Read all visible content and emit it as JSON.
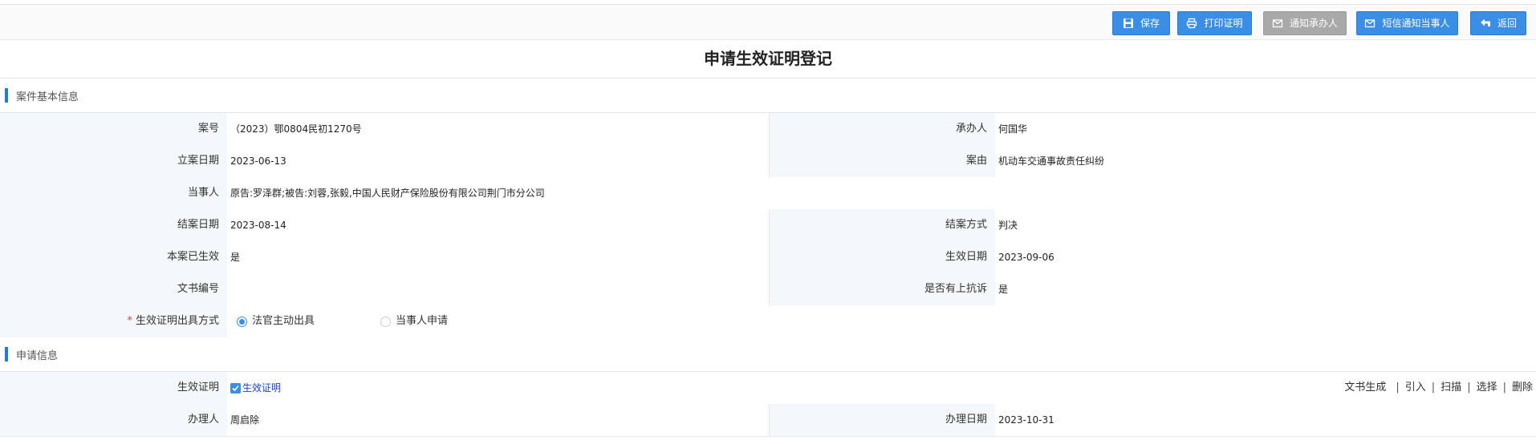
{
  "toolbar": {
    "save_label": "保存",
    "print_label": "打印证明",
    "notify_handler_label": "通知承办人",
    "sms_notify_label": "短信通知当事人",
    "back_label": "返回"
  },
  "page_title": "申请生效证明登记",
  "sections": {
    "case_info": "案件基本信息",
    "apply_info": "申请信息"
  },
  "case": {
    "case_no_label": "案号",
    "case_no": "（2023）鄂0804民初1270号",
    "handler_label": "承办人",
    "handler": "何国华",
    "filing_date_label": "立案日期",
    "filing_date": "2023-06-13",
    "cause_label": "案由",
    "cause": "机动车交通事故责任纠纷",
    "parties_label": "当事人",
    "parties": "原告:罗泽群;被告:刘蓉,张毅,中国人民财产保险股份有限公司荆门市分公司",
    "close_date_label": "结案日期",
    "close_date": "2023-08-14",
    "close_method_label": "结案方式",
    "close_method": "判决",
    "effective_label": "本案已生效",
    "effective": "是",
    "effective_date_label": "生效日期",
    "effective_date": "2023-09-06",
    "doc_no_label": "文书编号",
    "doc_no": "",
    "appeal_label": "是否有上抗诉",
    "appeal": "是",
    "issue_method_label": "生效证明出具方式",
    "required_mark": "*",
    "issue_options": [
      {
        "label": "法官主动出具",
        "selected": true
      },
      {
        "label": "当事人申请",
        "selected": false
      }
    ]
  },
  "apply": {
    "cert_label": "生效证明",
    "cert_link": "生效证明",
    "actions": [
      "文书生成",
      "引入",
      "扫描",
      "选择",
      "删除"
    ],
    "separator": "|",
    "operator_label": "办理人",
    "operator": "周启除",
    "handle_date_label": "办理日期",
    "handle_date": "2023-10-31"
  },
  "colors": {
    "accent": "#3a8ee6",
    "disabled": "#a9a9a9",
    "section_bar": "#1e7ce6",
    "required": "#e4393c",
    "link": "#1a3fd8"
  }
}
